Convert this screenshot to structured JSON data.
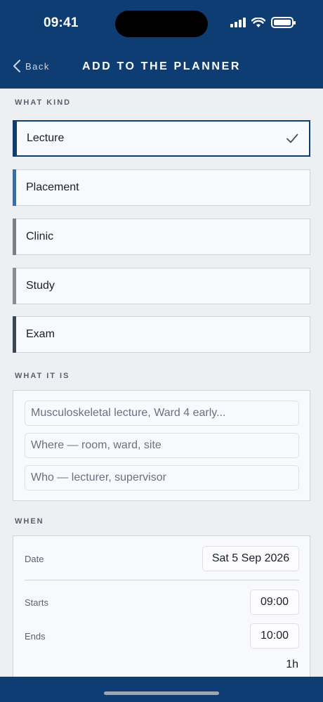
{
  "status": {
    "time": "09:41"
  },
  "header": {
    "back_label": "Back",
    "title": "ADD TO THE PLANNER"
  },
  "kind": {
    "section_label": "WHAT KIND",
    "items": [
      {
        "label": "Lecture",
        "selected": true,
        "color": "#0e3d73"
      },
      {
        "label": "Placement",
        "selected": false,
        "color": "#3f6e9c"
      },
      {
        "label": "Clinic",
        "selected": false,
        "color": "#7b7f88"
      },
      {
        "label": "Study",
        "selected": false,
        "color": "#8a8d94"
      },
      {
        "label": "Exam",
        "selected": false,
        "color": "#3d4553"
      }
    ]
  },
  "details": {
    "section_label": "WHAT IT IS",
    "title_placeholder": "Musculoskeletal lecture, Ward 4 early...",
    "where_placeholder": "Where — room, ward, site",
    "who_placeholder": "Who — lecturer, supervisor"
  },
  "when": {
    "section_label": "WHEN",
    "date_label": "Date",
    "date_value": "Sat 5 Sep 2026",
    "starts_label": "Starts",
    "starts_value": "09:00",
    "ends_label": "Ends",
    "ends_value": "10:00",
    "duration": "1h"
  },
  "colors": {
    "header_bg": "#0e3d73",
    "page_bg": "#eeeff3"
  }
}
